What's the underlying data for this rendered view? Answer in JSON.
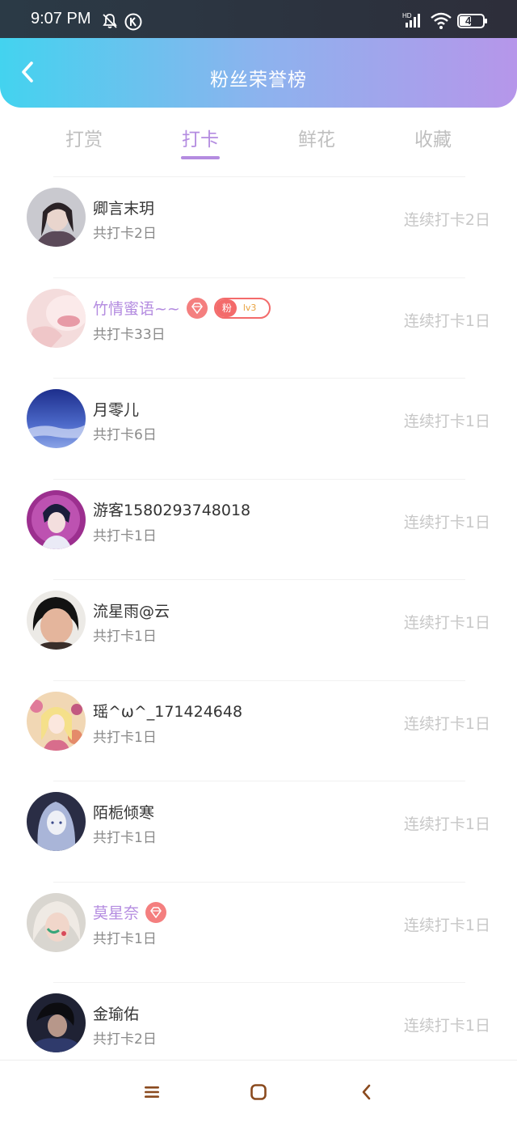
{
  "status_bar": {
    "time": "9:07 PM",
    "battery": "47",
    "network_label": "HD"
  },
  "header": {
    "title": "粉丝荣誉榜"
  },
  "tabs": [
    {
      "label": "打赏",
      "active": false
    },
    {
      "label": "打卡",
      "active": true
    },
    {
      "label": "鲜花",
      "active": false
    },
    {
      "label": "收藏",
      "active": false
    }
  ],
  "colors": {
    "accent": "#b48ce0",
    "header_gradient_start": "#43d3ef",
    "header_gradient_end": "#b696ea",
    "badge_red": "#f36b6b",
    "muted_text": "#c7c7c7"
  },
  "fans": [
    {
      "name": "卿言末玥",
      "total": "共打卡2日",
      "streak": "连续打卡2日",
      "vip": false,
      "gem": false,
      "fan_badge": null,
      "avatar": "avatar-woman-selfie"
    },
    {
      "name": "竹情蜜语~~",
      "total": "共打卡33日",
      "streak": "连续打卡1日",
      "vip": true,
      "gem": true,
      "fan_badge": {
        "label": "粉",
        "level": "lv3"
      },
      "avatar": "avatar-pink-lips"
    },
    {
      "name": "月零儿",
      "total": "共打卡6日",
      "streak": "连续打卡1日",
      "vip": false,
      "gem": false,
      "fan_badge": null,
      "avatar": "avatar-blue-sky"
    },
    {
      "name": "游客1580293748018",
      "total": "共打卡1日",
      "streak": "连续打卡1日",
      "vip": false,
      "gem": false,
      "fan_badge": null,
      "avatar": "avatar-anime-boy"
    },
    {
      "name": "流星雨@云",
      "total": "共打卡1日",
      "streak": "连续打卡1日",
      "vip": false,
      "gem": false,
      "fan_badge": null,
      "avatar": "avatar-woman-face"
    },
    {
      "name": "瑶^ω^_171424648",
      "total": "共打卡1日",
      "streak": "连续打卡1日",
      "vip": false,
      "gem": false,
      "fan_badge": null,
      "avatar": "avatar-anime-girl"
    },
    {
      "name": "陌栀倾寒",
      "total": "共打卡1日",
      "streak": "连续打卡1日",
      "vip": false,
      "gem": false,
      "fan_badge": null,
      "avatar": "avatar-fantasy-girl"
    },
    {
      "name": "莫星奈",
      "total": "共打卡1日",
      "streak": "连续打卡1日",
      "vip": true,
      "gem": true,
      "fan_badge": null,
      "avatar": "avatar-painted-face"
    },
    {
      "name": "金瑜佑",
      "total": "共打卡2日",
      "streak": "连续打卡1日",
      "vip": false,
      "gem": false,
      "fan_badge": null,
      "avatar": "avatar-dark-man"
    }
  ],
  "nav": {
    "buttons": [
      "menu-icon",
      "home-square-icon",
      "back-chevron-icon"
    ]
  }
}
